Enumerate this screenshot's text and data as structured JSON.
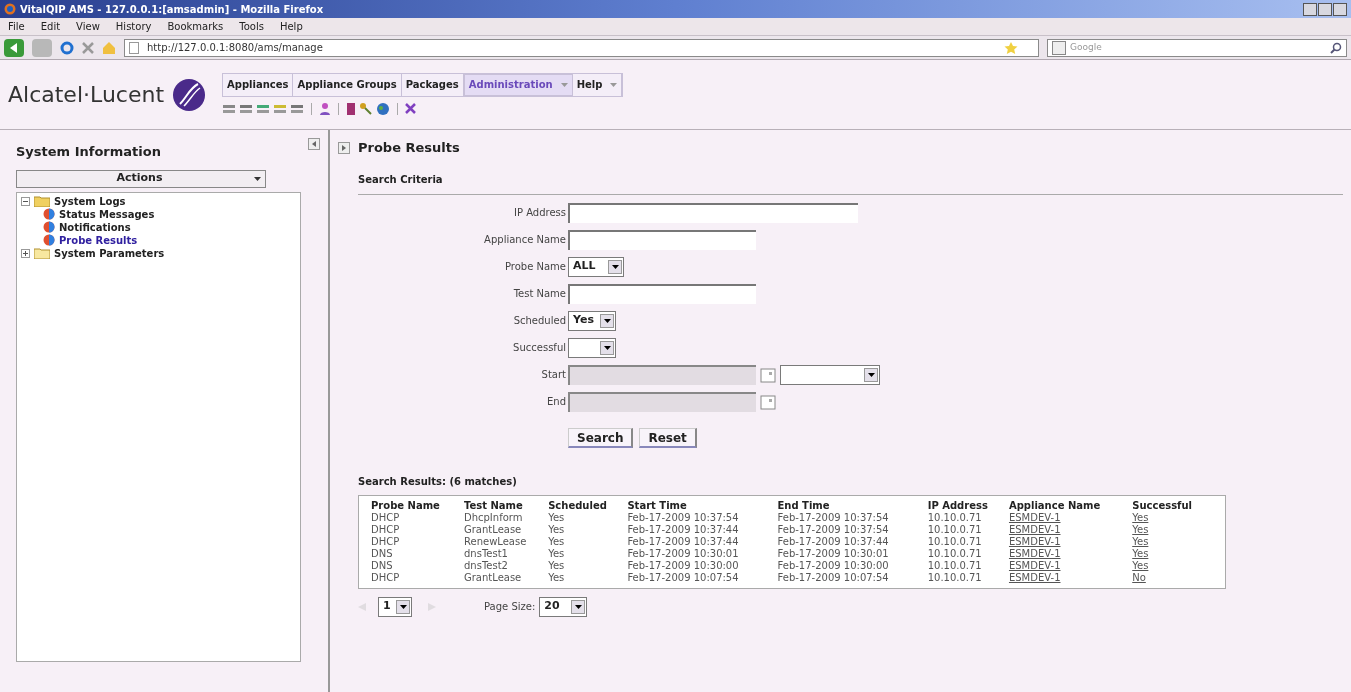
{
  "window": {
    "title": "VitalQIP AMS - 127.0.0.1:[amsadmin] - Mozilla Firefox"
  },
  "browser_menu": [
    "File",
    "Edit",
    "View",
    "History",
    "Bookmarks",
    "Tools",
    "Help"
  ],
  "address_bar": {
    "value": "http://127.0.0.1:8080/ams/manage"
  },
  "search_box": {
    "placeholder": "Google"
  },
  "brand": {
    "name": "Alcatel·Lucent"
  },
  "nav_tabs": [
    {
      "label": "Appliances",
      "selected": false,
      "has_menu": false
    },
    {
      "label": "Appliance Groups",
      "selected": false,
      "has_menu": false
    },
    {
      "label": "Packages",
      "selected": false,
      "has_menu": false
    },
    {
      "label": "Administration",
      "selected": true,
      "has_menu": true
    },
    {
      "label": "Help",
      "selected": false,
      "has_menu": true
    }
  ],
  "sidebar": {
    "title": "System Information",
    "actions": "Actions",
    "tree": [
      {
        "label": "System Logs",
        "expanded": true,
        "children": [
          {
            "label": "Status Messages",
            "selected": false
          },
          {
            "label": "Notifications",
            "selected": false
          },
          {
            "label": "Probe Results",
            "selected": true
          }
        ]
      },
      {
        "label": "System Parameters",
        "expanded": false
      }
    ]
  },
  "page": {
    "title": "Probe Results",
    "section": "Search Criteria",
    "fields": [
      {
        "label": "IP Address",
        "kind": "text"
      },
      {
        "label": "Appliance Name",
        "kind": "text"
      },
      {
        "label": "Probe Name",
        "kind": "select",
        "value": "ALL"
      },
      {
        "label": "Test Name",
        "kind": "text"
      },
      {
        "label": "Scheduled",
        "kind": "select",
        "value": "Yes"
      },
      {
        "label": "Successful",
        "kind": "select"
      },
      {
        "label": "Start",
        "kind": "date",
        "disabled": true,
        "time": true
      },
      {
        "label": "End",
        "kind": "date",
        "disabled": true,
        "time": false
      }
    ],
    "buttons": [
      "Search",
      "Reset"
    ],
    "results_title": "Search Results: (6 matches)",
    "table": {
      "columns": [
        "Probe Name",
        "Test Name",
        "Scheduled",
        "Start Time",
        "End Time",
        "IP Address",
        "Appliance Name",
        "Successful"
      ],
      "rows": [
        [
          "DHCP",
          "DhcpInform",
          "Yes",
          "Feb-17-2009 10:37:54",
          "Feb-17-2009 10:37:54",
          "10.10.0.71",
          "ESMDEV-1",
          "Yes"
        ],
        [
          "DHCP",
          "GrantLease",
          "Yes",
          "Feb-17-2009 10:37:44",
          "Feb-17-2009 10:37:54",
          "10.10.0.71",
          "ESMDEV-1",
          "Yes"
        ],
        [
          "DHCP",
          "RenewLease",
          "Yes",
          "Feb-17-2009 10:37:44",
          "Feb-17-2009 10:37:44",
          "10.10.0.71",
          "ESMDEV-1",
          "Yes"
        ],
        [
          "DNS",
          "dnsTest1",
          "Yes",
          "Feb-17-2009 10:30:01",
          "Feb-17-2009 10:30:01",
          "10.10.0.71",
          "ESMDEV-1",
          "Yes"
        ],
        [
          "DNS",
          "dnsTest2",
          "Yes",
          "Feb-17-2009 10:30:00",
          "Feb-17-2009 10:30:00",
          "10.10.0.71",
          "ESMDEV-1",
          "Yes"
        ],
        [
          "DHCP",
          "GrantLease",
          "Yes",
          "Feb-17-2009 10:07:54",
          "Feb-17-2009 10:07:54",
          "10.10.0.71",
          "ESMDEV-1",
          "No"
        ]
      ]
    },
    "pager": {
      "page": "1",
      "page_size_label": "Page Size:",
      "page_size": "20"
    }
  }
}
